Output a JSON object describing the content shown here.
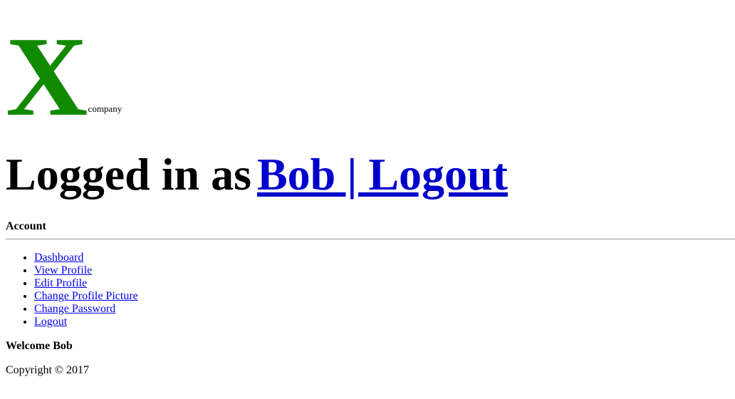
{
  "logo": {
    "letter": "X",
    "subtext": "company",
    "color": "#118a00"
  },
  "header": {
    "logged_in_text": "Logged in as",
    "user_logout_link": "Bob | Logout"
  },
  "account": {
    "title": "Account"
  },
  "nav": {
    "items": [
      {
        "label": "Dashboard"
      },
      {
        "label": "View Profile"
      },
      {
        "label": "Edit Profile"
      },
      {
        "label": "Change Profile Picture"
      },
      {
        "label": "Change Password"
      },
      {
        "label": "Logout"
      }
    ]
  },
  "main": {
    "welcome": "Welcome Bob"
  },
  "footer": {
    "copyright": "Copyright © 2017"
  },
  "colors": {
    "link": "#0000ee",
    "logo": "#118a00"
  }
}
